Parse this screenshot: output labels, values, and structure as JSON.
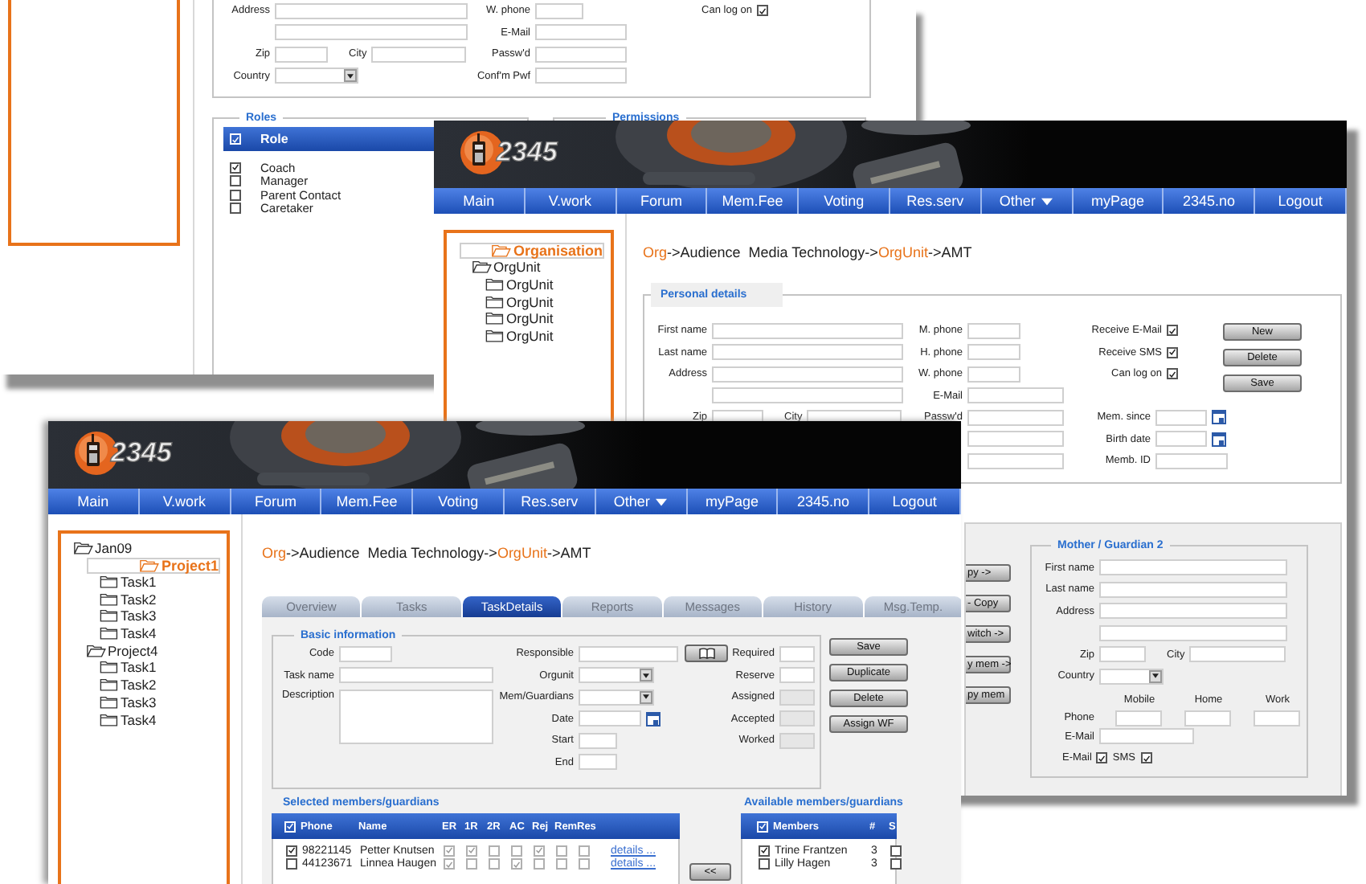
{
  "back_window": {
    "personal_form": {
      "columns": [
        {
          "rows": [
            {
              "kind": "text",
              "label": "Address"
            },
            {
              "kind": "text"
            },
            {
              "kind": "zipcity",
              "label": "Zip",
              "label2": "City"
            },
            {
              "kind": "select",
              "label": "Country"
            }
          ]
        },
        {
          "rows": [
            {
              "kind": "short",
              "label": "W. phone"
            },
            {
              "kind": "text",
              "label": "E-Mail"
            },
            {
              "kind": "text",
              "label": "Passw'd"
            },
            {
              "kind": "text",
              "label": "Conf'm Pwf"
            }
          ]
        },
        {
          "rows": [
            {
              "kind": "check",
              "label": "Can log on",
              "checked": true
            }
          ]
        }
      ]
    },
    "roles": {
      "legend": "Roles",
      "header": {
        "label": "Role",
        "checked": true
      },
      "items": [
        {
          "label": "Coach",
          "checked": true
        },
        {
          "label": "Manager",
          "checked": false
        },
        {
          "label": "Parent Contact",
          "checked": false
        },
        {
          "label": "Caretaker",
          "checked": false
        }
      ]
    },
    "permissions": {
      "legend": "Permissions"
    }
  },
  "middle_window": {
    "logo": "2345",
    "nav": [
      {
        "label": "Main",
        "dropdown": false
      },
      {
        "label": "V.work",
        "dropdown": false
      },
      {
        "label": "Forum",
        "dropdown": false
      },
      {
        "label": "Mem.Fee",
        "dropdown": false
      },
      {
        "label": "Voting",
        "dropdown": false
      },
      {
        "label": "Res.serv",
        "dropdown": false
      },
      {
        "label": "Other",
        "dropdown": true
      },
      {
        "label": "myPage",
        "dropdown": false
      },
      {
        "label": "2345.no",
        "dropdown": false
      },
      {
        "label": "Logout",
        "dropdown": false
      }
    ],
    "tree": [
      {
        "label": "Organisation",
        "selected": true,
        "expanded": true,
        "children": [
          {
            "label": "OrgUnit",
            "selected": false,
            "expanded": true,
            "children": [
              {
                "label": "OrgUnit",
                "selected": false,
                "expanded": false
              },
              {
                "label": "OrgUnit",
                "selected": false,
                "expanded": false
              },
              {
                "label": "OrgUnit",
                "selected": false,
                "expanded": false
              },
              {
                "label": "OrgUnit",
                "selected": false,
                "expanded": false
              }
            ]
          }
        ]
      }
    ],
    "breadcrumb": [
      {
        "text": "Org",
        "link": true
      },
      {
        "text": "->Audience  Media Technology->",
        "link": false
      },
      {
        "text": "OrgUnit",
        "link": true
      },
      {
        "text": "->AMT",
        "link": false
      }
    ],
    "personal_details": {
      "legend": "Personal details",
      "columns": [
        {
          "rows": [
            {
              "kind": "text",
              "label": "First name"
            },
            {
              "kind": "text",
              "label": "Last name"
            },
            {
              "kind": "text",
              "label": "Address"
            },
            {
              "kind": "text"
            },
            {
              "kind": "zipcity",
              "label": "Zip",
              "label2": "City"
            }
          ]
        },
        {
          "rows": [
            {
              "kind": "short",
              "label": "M. phone"
            },
            {
              "kind": "short",
              "label": "H. phone"
            },
            {
              "kind": "short",
              "label": "W. phone"
            },
            {
              "kind": "text",
              "label": "E-Mail"
            },
            {
              "kind": "text",
              "label": "Passw'd"
            },
            {
              "kind": "text"
            },
            {
              "kind": "text"
            }
          ]
        },
        {
          "rows": [
            {
              "kind": "check",
              "label": "Receive E-Mail",
              "checked": true
            },
            {
              "kind": "check",
              "label": "Receive SMS",
              "checked": true
            },
            {
              "kind": "check",
              "label": "Can log on",
              "checked": true
            }
          ],
          "lower_rows": [
            {
              "kind": "date",
              "label": "Mem. since"
            },
            {
              "kind": "date",
              "label": "Birth date"
            },
            {
              "kind": "medium",
              "label": "Memb. ID"
            }
          ]
        }
      ],
      "buttons": [
        "New",
        "Delete",
        "Save"
      ]
    },
    "side_buttons": [
      "py ->",
      "- Copy",
      "witch ->",
      "y mem ->",
      "py mem"
    ],
    "guardian": {
      "legend": "Mother / Guardian 2",
      "columns": [
        {
          "rows": [
            {
              "kind": "text",
              "label": "First name"
            },
            {
              "kind": "text",
              "label": "Last name"
            },
            {
              "kind": "text",
              "label": "Address"
            },
            {
              "kind": "text"
            },
            {
              "kind": "zipcity",
              "label": "Zip",
              "label2": "City"
            },
            {
              "kind": "select",
              "label": "Country"
            },
            {
              "kind": "phones",
              "label": "Phone",
              "headers": [
                "Mobile",
                "Home",
                "Work"
              ]
            },
            {
              "kind": "medium",
              "label": "E-Mail"
            },
            {
              "kind": "checks",
              "items": [
                {
                  "label": "E-Mail",
                  "checked": true
                },
                {
                  "label": "SMS",
                  "checked": true
                }
              ]
            }
          ]
        }
      ]
    }
  },
  "front_window": {
    "logo": "2345",
    "nav": [
      {
        "label": "Main",
        "dropdown": false
      },
      {
        "label": "V.work",
        "dropdown": false
      },
      {
        "label": "Forum",
        "dropdown": false
      },
      {
        "label": "Mem.Fee",
        "dropdown": false
      },
      {
        "label": "Voting",
        "dropdown": false
      },
      {
        "label": "Res.serv",
        "dropdown": false
      },
      {
        "label": "Other",
        "dropdown": true
      },
      {
        "label": "myPage",
        "dropdown": false
      },
      {
        "label": "2345.no",
        "dropdown": false
      },
      {
        "label": "Logout",
        "dropdown": false
      }
    ],
    "tree": [
      {
        "label": "Jan09",
        "selected": false,
        "expanded": true,
        "children": [
          {
            "label": "Project1",
            "selected": true,
            "expanded": true,
            "children": [
              {
                "label": "Task1",
                "selected": false,
                "expanded": false
              },
              {
                "label": "Task2",
                "selected": false,
                "expanded": false
              },
              {
                "label": "Task3",
                "selected": false,
                "expanded": false
              },
              {
                "label": "Task4",
                "selected": false,
                "expanded": false
              }
            ]
          },
          {
            "label": "Project4",
            "selected": false,
            "expanded": true,
            "children": [
              {
                "label": "Task1",
                "selected": false,
                "expanded": false
              },
              {
                "label": "Task2",
                "selected": false,
                "expanded": false
              },
              {
                "label": "Task3",
                "selected": false,
                "expanded": false
              },
              {
                "label": "Task4",
                "selected": false,
                "expanded": false
              }
            ]
          }
        ]
      }
    ],
    "breadcrumb": [
      {
        "text": "Org",
        "link": true
      },
      {
        "text": "->Audience  Media Technology->",
        "link": false
      },
      {
        "text": "OrgUnit",
        "link": true
      },
      {
        "text": "->AMT",
        "link": false
      }
    ],
    "tabs": [
      {
        "label": "Overview",
        "selected": false
      },
      {
        "label": "Tasks",
        "selected": false
      },
      {
        "label": "TaskDetails",
        "selected": true
      },
      {
        "label": "Reports",
        "selected": false
      },
      {
        "label": "Messages",
        "selected": false
      },
      {
        "label": "History",
        "selected": false
      },
      {
        "label": "Msg.Temp.",
        "selected": false
      }
    ],
    "basic_info": {
      "legend": "Basic information",
      "columns": [
        {
          "rows": [
            {
              "kind": "short",
              "label": "Code"
            },
            {
              "kind": "text",
              "label": "Task name"
            },
            {
              "kind": "textarea",
              "label": "Description"
            }
          ]
        },
        {
          "rows": [
            {
              "kind": "lookup",
              "label": "Responsible"
            },
            {
              "kind": "select",
              "label": "Orgunit"
            },
            {
              "kind": "select",
              "label": "Mem/Guardians"
            },
            {
              "kind": "date",
              "label": "Date"
            },
            {
              "kind": "short",
              "label": "Start"
            },
            {
              "kind": "short",
              "label": "End"
            }
          ]
        },
        {
          "rows": [
            {
              "kind": "short",
              "label": "Required"
            },
            {
              "kind": "short",
              "label": "Reserve"
            },
            {
              "kind": "readonly",
              "label": "Assigned"
            },
            {
              "kind": "readonly",
              "label": "Accepted"
            },
            {
              "kind": "readonly",
              "label": "Worked"
            }
          ]
        }
      ],
      "buttons": [
        "Save",
        "Duplicate",
        "Delete",
        "Assign WF"
      ]
    },
    "selected_members": {
      "title": "Selected members/guardians",
      "header_checked": true,
      "columns": [
        "Phone",
        "Name",
        "ER",
        "1R",
        "2R",
        "AC",
        "Rej",
        "Rem",
        "Res"
      ],
      "rows": [
        {
          "checked": true,
          "phone": "98221145",
          "name": "Petter Knutsen",
          "flags": [
            {
              "checked": true
            },
            {
              "checked": true
            },
            {
              "checked": false
            },
            {
              "checked": false
            },
            {
              "checked": true
            },
            {
              "checked": false
            },
            {
              "checked": false
            }
          ],
          "link": "details ..."
        },
        {
          "checked": false,
          "phone": "44123671",
          "name": "Linnea Haugen",
          "flags": [
            {
              "checked": true
            },
            {
              "checked": false
            },
            {
              "checked": false
            },
            {
              "checked": true
            },
            {
              "checked": false
            },
            {
              "checked": false
            },
            {
              "checked": false
            }
          ],
          "link": "details ..."
        }
      ]
    },
    "move_button": "<<",
    "available_members": {
      "title": "Available members/guardians",
      "header_checked": true,
      "columns": [
        "Members",
        "#",
        "S"
      ],
      "rows": [
        {
          "checked": true,
          "name": "Trine Frantzen",
          "count": "3",
          "s_checked": false
        },
        {
          "checked": false,
          "name": "Lilly Hagen",
          "count": "3",
          "s_checked": false
        }
      ]
    }
  }
}
